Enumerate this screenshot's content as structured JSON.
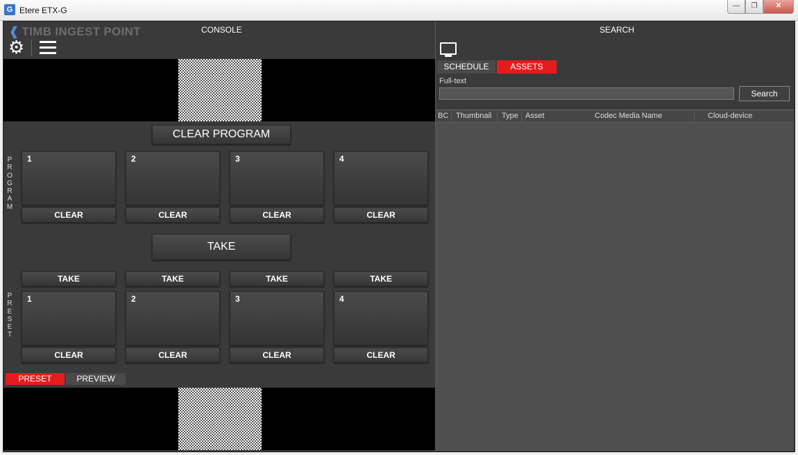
{
  "window": {
    "title": "Etere ETX-G",
    "app_icon": "G"
  },
  "left": {
    "app_title": "TIMB INGEST POINT",
    "console_label": "CONSOLE",
    "clear_program": "CLEAR PROGRAM",
    "take_big": "TAKE",
    "program_label": [
      "P",
      "R",
      "O",
      "G",
      "R",
      "A",
      "M"
    ],
    "preset_label": [
      "P",
      "R",
      "E",
      "S",
      "E",
      "T"
    ],
    "program_tiles": [
      "1",
      "2",
      "3",
      "4"
    ],
    "preset_tiles": [
      "1",
      "2",
      "3",
      "4"
    ],
    "clear_label": "CLEAR",
    "take_label": "TAKE",
    "tabs": {
      "preset": "PRESET",
      "preview": "PREVIEW"
    }
  },
  "right": {
    "search_label": "SEARCH",
    "tabs": {
      "schedule": "SCHEDULE",
      "assets": "ASSETS"
    },
    "fulltext_label": "Full-text",
    "fulltext_value": "",
    "search_button": "Search",
    "columns": [
      "BC",
      "Thumbnail",
      "Type",
      "Asset",
      "Codec Media Name",
      "Cloud-device"
    ]
  },
  "colors": {
    "accent_red": "#e51c1c",
    "panel": "#3a3a3a"
  }
}
